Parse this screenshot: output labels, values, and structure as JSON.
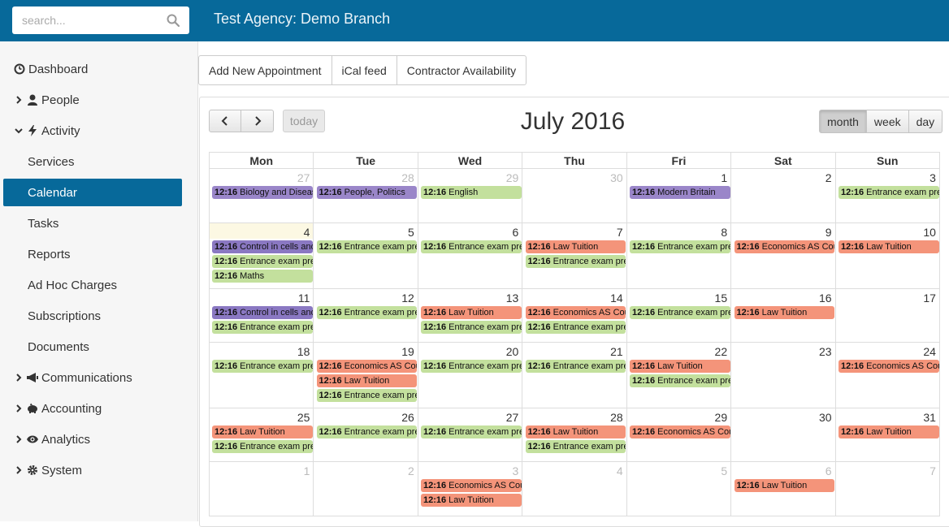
{
  "header": {
    "search_placeholder": "search...",
    "brand": "Test Agency: Demo Branch"
  },
  "sidebar": {
    "items": [
      {
        "label": "Dashboard",
        "icon": "dashboard-icon"
      },
      {
        "label": "People",
        "icon": "person-icon"
      },
      {
        "label": "Activity",
        "icon": "bolt-icon"
      },
      {
        "label": "Services"
      },
      {
        "label": "Calendar",
        "active": true
      },
      {
        "label": "Tasks"
      },
      {
        "label": "Reports"
      },
      {
        "label": "Ad Hoc Charges"
      },
      {
        "label": "Subscriptions"
      },
      {
        "label": "Documents"
      },
      {
        "label": "Communications",
        "icon": "megaphone-icon"
      },
      {
        "label": "Accounting",
        "icon": "piggy-bank-icon"
      },
      {
        "label": "Analytics",
        "icon": "eye-icon"
      },
      {
        "label": "System",
        "icon": "gear-icon"
      }
    ]
  },
  "actions": {
    "add_appointment": "Add New Appointment",
    "ical_feed": "iCal feed",
    "contractor_availability": "Contractor Availability"
  },
  "calendar": {
    "title": "July 2016",
    "today_label": "today",
    "views": {
      "month": "month",
      "week": "week",
      "day": "day"
    },
    "weekdays": [
      "Mon",
      "Tue",
      "Wed",
      "Thu",
      "Fri",
      "Sat",
      "Sun"
    ],
    "colors": {
      "green": "#c3e09d",
      "red": "#f4947a",
      "purple": "#9a86c9",
      "accent": "#07699a"
    },
    "weeks": [
      {
        "days": [
          {
            "n": "27",
            "other": true
          },
          {
            "n": "28",
            "other": true
          },
          {
            "n": "29",
            "other": true
          },
          {
            "n": "30",
            "other": true
          },
          {
            "n": "1"
          },
          {
            "n": "2"
          },
          {
            "n": "3"
          }
        ],
        "events": [
          {
            "day": 0,
            "slot": 0,
            "time": "12:16",
            "title": "Biology and Disease",
            "color": "purple"
          },
          {
            "day": 1,
            "slot": 0,
            "time": "12:16",
            "title": "People, Politics",
            "color": "purple"
          },
          {
            "day": 2,
            "slot": 0,
            "time": "12:16",
            "title": "English",
            "color": "green"
          },
          {
            "day": 4,
            "slot": 0,
            "time": "12:16",
            "title": "Modern Britain",
            "color": "purple"
          },
          {
            "day": 6,
            "slot": 0,
            "time": "12:16",
            "title": "Entrance exam preparation",
            "color": "green"
          }
        ]
      },
      {
        "days": [
          {
            "n": "4",
            "today": true
          },
          {
            "n": "5"
          },
          {
            "n": "6"
          },
          {
            "n": "7"
          },
          {
            "n": "8"
          },
          {
            "n": "9"
          },
          {
            "n": "10"
          }
        ],
        "events": [
          {
            "day": 0,
            "slot": 0,
            "time": "12:16",
            "title": "Control in cells and organisms",
            "color": "dkpurple"
          },
          {
            "day": 0,
            "slot": 1,
            "time": "12:16",
            "title": "Entrance exam preparation",
            "color": "green"
          },
          {
            "day": 0,
            "slot": 2,
            "time": "12:16",
            "title": "Maths",
            "color": "green"
          },
          {
            "day": 1,
            "slot": 0,
            "time": "12:16",
            "title": "Entrance exam preparation",
            "color": "green"
          },
          {
            "day": 2,
            "slot": 0,
            "time": "12:16",
            "title": "Entrance exam preparation",
            "color": "green"
          },
          {
            "day": 3,
            "slot": 0,
            "time": "12:16",
            "title": "Law Tuition",
            "color": "red"
          },
          {
            "day": 3,
            "slot": 1,
            "time": "12:16",
            "title": "Entrance exam preparation",
            "color": "green"
          },
          {
            "day": 4,
            "slot": 0,
            "time": "12:16",
            "title": "Entrance exam preparation",
            "color": "green"
          },
          {
            "day": 5,
            "slot": 0,
            "time": "12:16",
            "title": "Economics AS Coursework",
            "color": "red"
          },
          {
            "day": 6,
            "slot": 0,
            "time": "12:16",
            "title": "Law Tuition",
            "color": "red"
          }
        ]
      },
      {
        "days": [
          {
            "n": "11"
          },
          {
            "n": "12"
          },
          {
            "n": "13"
          },
          {
            "n": "14"
          },
          {
            "n": "15"
          },
          {
            "n": "16"
          },
          {
            "n": "17"
          }
        ],
        "events": [
          {
            "day": 0,
            "slot": 0,
            "time": "12:16",
            "title": "Control in cells and organisms",
            "color": "dkpurple"
          },
          {
            "day": 0,
            "slot": 1,
            "time": "12:16",
            "title": "Entrance exam preparation",
            "color": "green"
          },
          {
            "day": 1,
            "slot": 0,
            "time": "12:16",
            "title": "Entrance exam preparation",
            "color": "green"
          },
          {
            "day": 2,
            "slot": 0,
            "time": "12:16",
            "title": "Law Tuition",
            "color": "red"
          },
          {
            "day": 2,
            "slot": 1,
            "time": "12:16",
            "title": "Entrance exam preparation",
            "color": "green"
          },
          {
            "day": 3,
            "slot": 0,
            "time": "12:16",
            "title": "Economics AS Coursework",
            "color": "red"
          },
          {
            "day": 3,
            "slot": 1,
            "time": "12:16",
            "title": "Entrance exam preparation",
            "color": "green"
          },
          {
            "day": 4,
            "slot": 0,
            "time": "12:16",
            "title": "Entrance exam preparation",
            "color": "green"
          },
          {
            "day": 5,
            "slot": 0,
            "time": "12:16",
            "title": "Law Tuition",
            "color": "red"
          }
        ]
      },
      {
        "days": [
          {
            "n": "18"
          },
          {
            "n": "19"
          },
          {
            "n": "20"
          },
          {
            "n": "21"
          },
          {
            "n": "22"
          },
          {
            "n": "23"
          },
          {
            "n": "24"
          }
        ],
        "events": [
          {
            "day": 0,
            "slot": 0,
            "time": "12:16",
            "title": "Entrance exam preparation",
            "color": "green"
          },
          {
            "day": 1,
            "slot": 0,
            "time": "12:16",
            "title": "Economics AS Coursework",
            "color": "red"
          },
          {
            "day": 1,
            "slot": 1,
            "time": "12:16",
            "title": "Law Tuition",
            "color": "red"
          },
          {
            "day": 1,
            "slot": 2,
            "time": "12:16",
            "title": "Entrance exam preparation",
            "color": "green"
          },
          {
            "day": 2,
            "slot": 0,
            "time": "12:16",
            "title": "Entrance exam preparation",
            "color": "green"
          },
          {
            "day": 3,
            "slot": 0,
            "time": "12:16",
            "title": "Entrance exam preparation",
            "color": "green"
          },
          {
            "day": 4,
            "slot": 0,
            "time": "12:16",
            "title": "Law Tuition",
            "color": "red"
          },
          {
            "day": 4,
            "slot": 1,
            "time": "12:16",
            "title": "Entrance exam preparation",
            "color": "green"
          },
          {
            "day": 6,
            "slot": 0,
            "time": "12:16",
            "title": "Economics AS Coursework",
            "color": "red"
          }
        ]
      },
      {
        "days": [
          {
            "n": "25"
          },
          {
            "n": "26"
          },
          {
            "n": "27"
          },
          {
            "n": "28"
          },
          {
            "n": "29"
          },
          {
            "n": "30"
          },
          {
            "n": "31"
          }
        ],
        "events": [
          {
            "day": 0,
            "slot": 0,
            "time": "12:16",
            "title": "Law Tuition",
            "color": "red"
          },
          {
            "day": 0,
            "slot": 1,
            "time": "12:16",
            "title": "Entrance exam preparation",
            "color": "green"
          },
          {
            "day": 1,
            "slot": 0,
            "time": "12:16",
            "title": "Entrance exam preparation",
            "color": "green"
          },
          {
            "day": 2,
            "slot": 0,
            "time": "12:16",
            "title": "Entrance exam preparation",
            "color": "green"
          },
          {
            "day": 3,
            "slot": 0,
            "time": "12:16",
            "title": "Law Tuition",
            "color": "red"
          },
          {
            "day": 3,
            "slot": 1,
            "time": "12:16",
            "title": "Entrance exam preparation",
            "color": "green"
          },
          {
            "day": 4,
            "slot": 0,
            "time": "12:16",
            "title": "Economics AS Coursework",
            "color": "red"
          },
          {
            "day": 6,
            "slot": 0,
            "time": "12:16",
            "title": "Law Tuition",
            "color": "red"
          }
        ]
      },
      {
        "days": [
          {
            "n": "1",
            "other": true
          },
          {
            "n": "2",
            "other": true
          },
          {
            "n": "3",
            "other": true
          },
          {
            "n": "4",
            "other": true
          },
          {
            "n": "5",
            "other": true
          },
          {
            "n": "6",
            "other": true
          },
          {
            "n": "7",
            "other": true
          }
        ],
        "events": [
          {
            "day": 2,
            "slot": 0,
            "time": "12:16",
            "title": "Economics AS Coursework",
            "color": "red"
          },
          {
            "day": 2,
            "slot": 1,
            "time": "12:16",
            "title": "Law Tuition",
            "color": "red"
          },
          {
            "day": 5,
            "slot": 0,
            "time": "12:16",
            "title": "Law Tuition",
            "color": "red"
          }
        ]
      }
    ]
  }
}
